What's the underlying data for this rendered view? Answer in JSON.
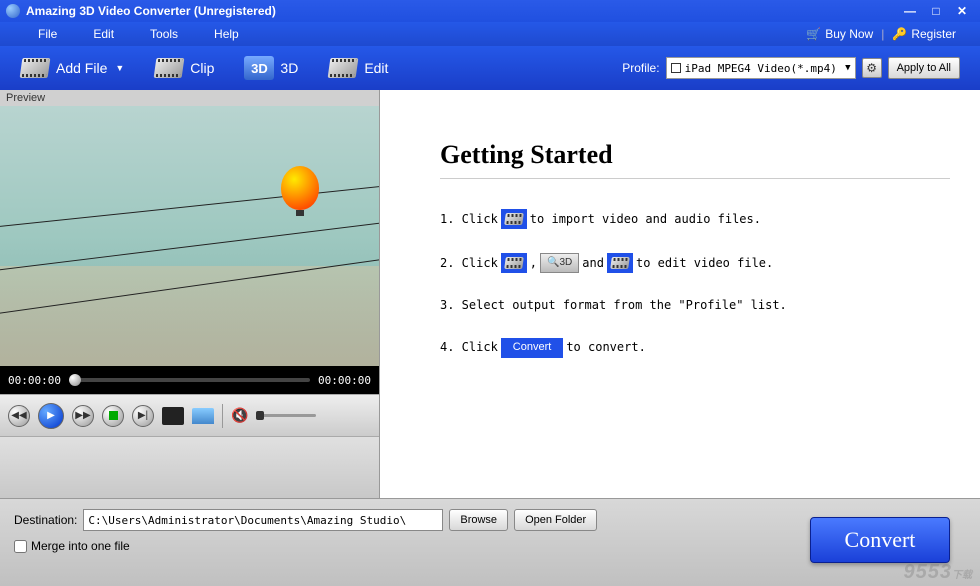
{
  "title": "Amazing 3D Video Converter (Unregistered)",
  "menu": {
    "file": "File",
    "edit": "Edit",
    "tools": "Tools",
    "help": "Help"
  },
  "topLinks": {
    "buyNow": "Buy Now",
    "register": "Register"
  },
  "toolbar": {
    "addFile": "Add File",
    "clip": "Clip",
    "threeD": "3D",
    "edit": "Edit",
    "profileLabel": "Profile:",
    "profileValue": "iPad MPEG4 Video(*.mp4)",
    "applyAll": "Apply to All"
  },
  "preview": {
    "label": "Preview",
    "timeStart": "00:00:00",
    "timeEnd": "00:00:00"
  },
  "gettingStarted": {
    "title": "Getting Started",
    "step1_a": "1. Click",
    "step1_b": "to import video and audio files.",
    "step2_a": "2. Click",
    "step2_comma": ",",
    "step2_3d": "3D",
    "step2_and": "and",
    "step2_b": "to edit video file.",
    "step3": "3. Select output format from the \"Profile\" list.",
    "step4_a": "4. Click",
    "step4_convert": "Convert",
    "step4_b": "to convert."
  },
  "bottom": {
    "destLabel": "Destination:",
    "destPath": "C:\\Users\\Administrator\\Documents\\Amazing Studio\\",
    "browse": "Browse",
    "openFolder": "Open Folder",
    "merge": "Merge into one file",
    "convert": "Convert"
  },
  "watermark": "9553",
  "watermarkSub": "下载"
}
